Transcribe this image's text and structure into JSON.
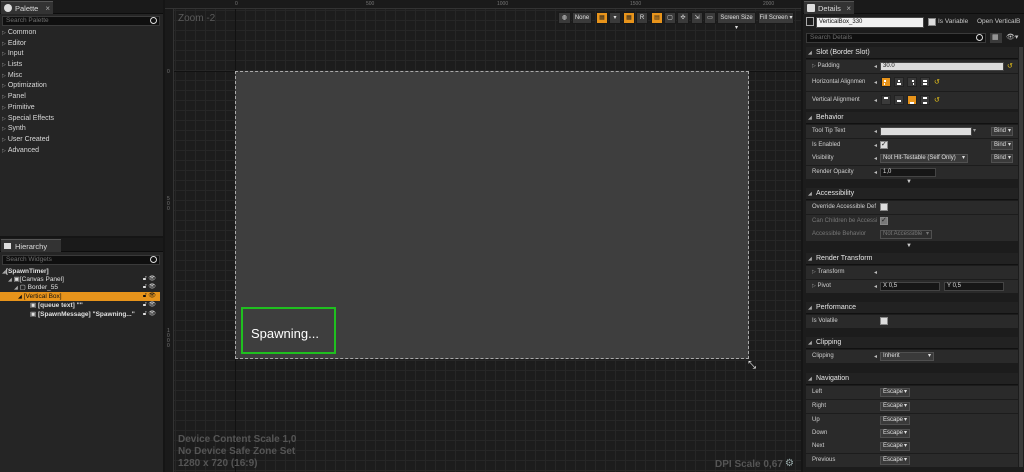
{
  "palette": {
    "tab_label": "Palette",
    "search_placeholder": "Search Palette",
    "categories": [
      "Common",
      "Editor",
      "Input",
      "Lists",
      "Misc",
      "Optimization",
      "Panel",
      "Primitive",
      "Special Effects",
      "Synth",
      "User Created",
      "Advanced"
    ]
  },
  "hierarchy": {
    "tab_label": "Hierarchy",
    "search_placeholder": "Search Widgets",
    "rows": [
      "[SpawnTimer]",
      "[Canvas Panel]",
      "Border_55",
      "[Vertical Box]",
      "[queue text] \"\"",
      "[SpawnMessage] \"Spawning...\""
    ]
  },
  "viewport": {
    "zoom_label": "Zoom -2",
    "ruler_ticks": [
      "0",
      "500",
      "1000",
      "1500",
      "2000"
    ],
    "vruler_ticks": [
      "0",
      "500",
      "1000"
    ],
    "widget_text": "Spawning...",
    "toolbar": {
      "none_label": "None",
      "r_label": "R",
      "screen_size": "Screen Size",
      "fill_screen": "Fill Screen"
    },
    "info_line1": "Device Content Scale 1,0",
    "info_line2": "No Device Safe Zone Set",
    "info_line3": "1280 x 720 (16:9)",
    "dpi_scale": "DPI Scale 0,67"
  },
  "details": {
    "tab_label": "Details",
    "name_value": "VerticalBox_330",
    "is_variable_label": "Is Variable",
    "open_label": "Open VerticalB",
    "search_placeholder": "Search Details",
    "sections": {
      "slot": "Slot (Border Slot)",
      "behavior": "Behavior",
      "accessibility": "Accessibility",
      "render_transform": "Render Transform",
      "performance": "Performance",
      "clipping": "Clipping",
      "navigation": "Navigation"
    },
    "padding_label": "Padding",
    "padding_value": "30.0",
    "halign_label": "Horizontal Alignmen",
    "valign_label": "Vertical Alignment",
    "tooltip_label": "Tool Tip Text",
    "is_enabled_label": "Is Enabled",
    "visibility_label": "Visibility",
    "visibility_value": "Not Hit-Testable (Self Only)",
    "render_opacity_label": "Render Opacity",
    "render_opacity_value": "1,0",
    "bind_label": "Bind",
    "override_label": "Override Accessible Def",
    "can_children_label": "Can Children be Accessi",
    "acc_behavior_label": "Accessible Behavior",
    "acc_behavior_value": "Not Accessible",
    "transform_label": "Transform",
    "pivot_label": "Pivot",
    "pivot_x_label": "X",
    "pivot_x": "0,5",
    "pivot_y_label": "Y",
    "pivot_y": "0,5",
    "is_volatile_label": "Is Volatile",
    "clipping_label": "Clipping",
    "clipping_value": "Inherit",
    "nav_rows": [
      {
        "label": "Left",
        "value": "Escape"
      },
      {
        "label": "Right",
        "value": "Escape"
      },
      {
        "label": "Up",
        "value": "Escape"
      },
      {
        "label": "Down",
        "value": "Escape"
      },
      {
        "label": "Next",
        "value": "Escape"
      },
      {
        "label": "Previous",
        "value": "Escape"
      }
    ]
  },
  "colors": {
    "accent_orange": "#e8941b",
    "selection_green": "#1fbf1f",
    "canvas_gray": "#3e3e3e"
  }
}
